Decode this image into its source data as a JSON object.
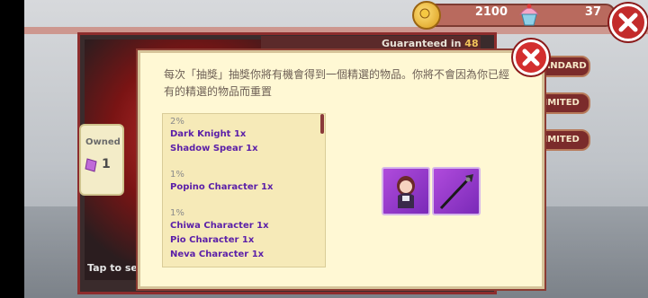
{
  "hud": {
    "coins": "2100",
    "cakes": "37",
    "coin_icon": "coin-icon",
    "cake_icon": "cupcake-icon",
    "close_icon": "close-icon"
  },
  "gacha": {
    "guaranteed_label": "Guaranteed in",
    "guaranteed_count": "48",
    "owned_label": "Owned",
    "owned_count": "1",
    "tap_hint": "Tap to se",
    "tabs": [
      "STANDARD",
      "LIMITED",
      "LIMITED"
    ]
  },
  "modal": {
    "note": "每次「抽獎」抽獎你將有機會得到一個精選的物品。你將不會因為你已經有的精選的物品而重置",
    "groups": [
      {
        "pct": "2%",
        "items": [
          "Dark Knight 1x",
          "Shadow Spear 1x"
        ]
      },
      {
        "pct": "1%",
        "items": [
          "Popino Character 1x"
        ]
      },
      {
        "pct": "1%",
        "items": [
          "Chiwa Character 1x",
          "Pio Character 1x",
          "Neva Character 1x"
        ]
      }
    ],
    "rewards": [
      {
        "name": "character-portrait"
      },
      {
        "name": "spear-weapon"
      }
    ]
  },
  "colors": {
    "modal_bg": "#fff8d4",
    "item_text": "#5a1ea8",
    "close_red": "#d32e2e",
    "reward_purple": "#9b3bd0"
  }
}
